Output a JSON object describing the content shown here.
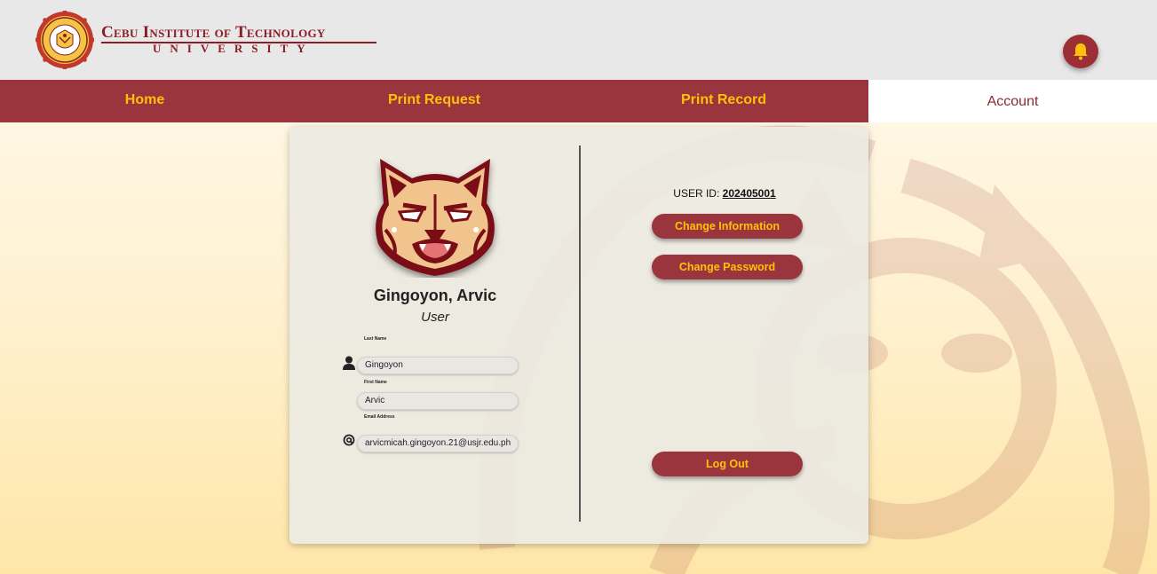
{
  "header": {
    "logo_line1": "Cebu Institute of Technology",
    "logo_line2": "UNIVERSITY",
    "notification_icon": "bell-icon"
  },
  "nav": {
    "items": [
      {
        "label": "Home"
      },
      {
        "label": "Print Request"
      },
      {
        "label": "Print Record"
      },
      {
        "label": "Account"
      }
    ]
  },
  "profile": {
    "name": "Gingoyon, Arvic",
    "role": "User",
    "fields": {
      "last_name_label": "Last Name",
      "last_name_value": "Gingoyon",
      "first_name_label": "First Name",
      "first_name_value": "Arvic",
      "email_label": "Email Address",
      "email_value": "arvicmicah.gingoyon.21@usjr.edu.ph"
    },
    "icons": {
      "user": "user-icon",
      "email": "at-sign-icon"
    }
  },
  "account": {
    "user_id_label": "USER ID:",
    "user_id_value": "202405001",
    "change_info_label": "Change Information",
    "change_password_label": "Change Password",
    "logout_label": "Log Out"
  },
  "colors": {
    "brand_maroon": "#9b353d",
    "accent_gold": "#ffc107",
    "header_bg": "#e8e8e8"
  }
}
